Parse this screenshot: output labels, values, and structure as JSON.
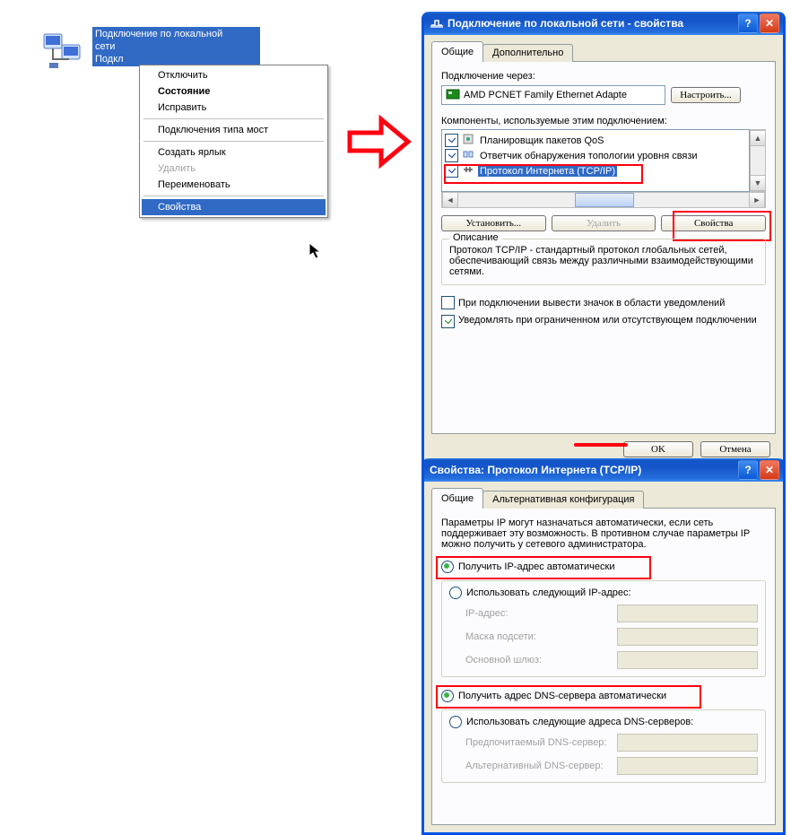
{
  "desktop": {
    "icon_label_line1": "Подключение по локальной",
    "icon_label_line2": "сети",
    "icon_label_line3": "Подкл"
  },
  "context_menu": {
    "items": [
      {
        "label": "Отключить",
        "bold": false,
        "disabled": false,
        "sep": false
      },
      {
        "label": "Состояние",
        "bold": true,
        "disabled": false,
        "sep": false
      },
      {
        "label": "Исправить",
        "bold": false,
        "disabled": false,
        "sep": false
      },
      {
        "sep": true
      },
      {
        "label": "Подключения типа мост",
        "bold": false,
        "disabled": false,
        "sep": false
      },
      {
        "sep": true
      },
      {
        "label": "Создать ярлык",
        "bold": false,
        "disabled": false,
        "sep": false
      },
      {
        "label": "Удалить",
        "bold": false,
        "disabled": true,
        "sep": false
      },
      {
        "label": "Переименовать",
        "bold": false,
        "disabled": false,
        "sep": false
      },
      {
        "sep": true
      },
      {
        "label": "Свойства",
        "bold": false,
        "disabled": false,
        "sep": false,
        "selected": true
      }
    ]
  },
  "win1": {
    "title": "Подключение по локальной сети - свойства",
    "tabs": {
      "general": "Общие",
      "advanced": "Дополнительно"
    },
    "connect_via_label": "Подключение через:",
    "adapter": "AMD PCNET Family Ethernet Adapte",
    "configure_btn": "Настроить...",
    "components_label": "Компоненты, используемые этим подключением:",
    "components": [
      {
        "checked": true,
        "icon": "qos",
        "label": "Планировщик пакетов QoS",
        "selected": false
      },
      {
        "checked": true,
        "icon": "topology",
        "label": "Ответчик обнаружения топологии уровня связи",
        "selected": false
      },
      {
        "checked": true,
        "icon": "tcpip",
        "label": "Протокол Интернета (TCP/IP)",
        "selected": true
      }
    ],
    "install_btn": "Установить...",
    "remove_btn": "Удалить",
    "properties_btn": "Свойства",
    "desc_legend": "Описание",
    "desc_text": "Протокол TCP/IP - стандартный протокол глобальных сетей, обеспечивающий связь между различными взаимодействующими сетями.",
    "notify_icon": "При подключении вывести значок в области уведомлений",
    "notify_limited": "Уведомлять при ограниченном или отсутствующем подключении",
    "ok": "OK",
    "cancel": "Отмена"
  },
  "win2": {
    "title": "Свойства: Протокол Интернета (TCP/IP)",
    "tabs": {
      "general": "Общие",
      "alt": "Альтернативная конфигурация"
    },
    "intro": "Параметры IP могут назначаться автоматически, если сеть поддерживает эту возможность. В противном случае параметры IP можно получить у сетевого администратора.",
    "ip_auto": "Получить IP-адрес автоматически",
    "ip_manual": "Использовать следующий IP-адрес:",
    "ip_addr": "IP-адрес:",
    "mask": "Маска подсети:",
    "gateway": "Основной шлюз:",
    "dns_auto": "Получить адрес DNS-сервера автоматически",
    "dns_manual": "Использовать следующие адреса DNS-серверов:",
    "dns_pref": "Предпочитаемый DNS-сервер:",
    "dns_alt": "Альтернативный DNS-сервер:"
  }
}
